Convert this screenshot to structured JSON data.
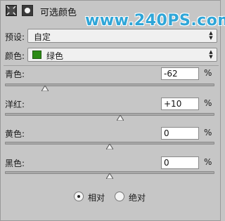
{
  "header": {
    "title": "可选颜色",
    "watermark": "www.240PS.com",
    "adjust_icon": "adjustment-layer-icon",
    "mask_icon": "mask-icon"
  },
  "preset": {
    "label": "预设:",
    "value": "自定"
  },
  "colors": {
    "label": "颜色:",
    "value": "绿色",
    "swatch": "#2b8a14"
  },
  "sliders": [
    {
      "name": "cyan",
      "label": "青色:",
      "value": "-62",
      "unit": "%",
      "level_pct": -62
    },
    {
      "name": "magenta",
      "label": "洋红:",
      "value": "+10",
      "unit": "%",
      "level_pct": 10
    },
    {
      "name": "yellow",
      "label": "黄色:",
      "value": "0",
      "unit": "%",
      "level_pct": 0
    },
    {
      "name": "black",
      "label": "黑色:",
      "value": "0",
      "unit": "%",
      "level_pct": 0
    }
  ],
  "method": {
    "relative_label": "相对",
    "absolute_label": "绝对",
    "selected": "relative"
  }
}
